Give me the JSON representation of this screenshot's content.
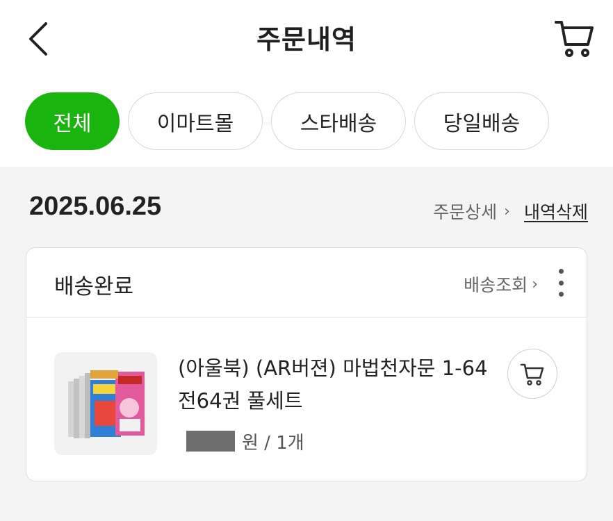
{
  "header": {
    "title": "주문내역",
    "back_icon": "chevron-left-icon",
    "cart_icon": "cart-icon"
  },
  "tabs": [
    {
      "label": "전체",
      "active": true
    },
    {
      "label": "이마트몰",
      "active": false
    },
    {
      "label": "스타배송",
      "active": false
    },
    {
      "label": "당일배송",
      "active": false
    }
  ],
  "order": {
    "date": "2025.06.25",
    "detail_label": "주문상세",
    "detail_chevron": "›",
    "delete_label": "내역삭제",
    "status": "배송완료",
    "track_label": "배송조회",
    "track_chevron": "›",
    "item": {
      "name": "(아울북) (AR버젼) 마법천자문 1-64 전64권 풀세트",
      "price_suffix": "원 / 1개",
      "thumbnail_icon": "book-set-image",
      "add_cart_icon": "cart-icon"
    }
  },
  "colors": {
    "accent": "#1ab40f",
    "background": "#f4f4f4",
    "card": "#ffffff",
    "border": "#dcdcdc"
  }
}
